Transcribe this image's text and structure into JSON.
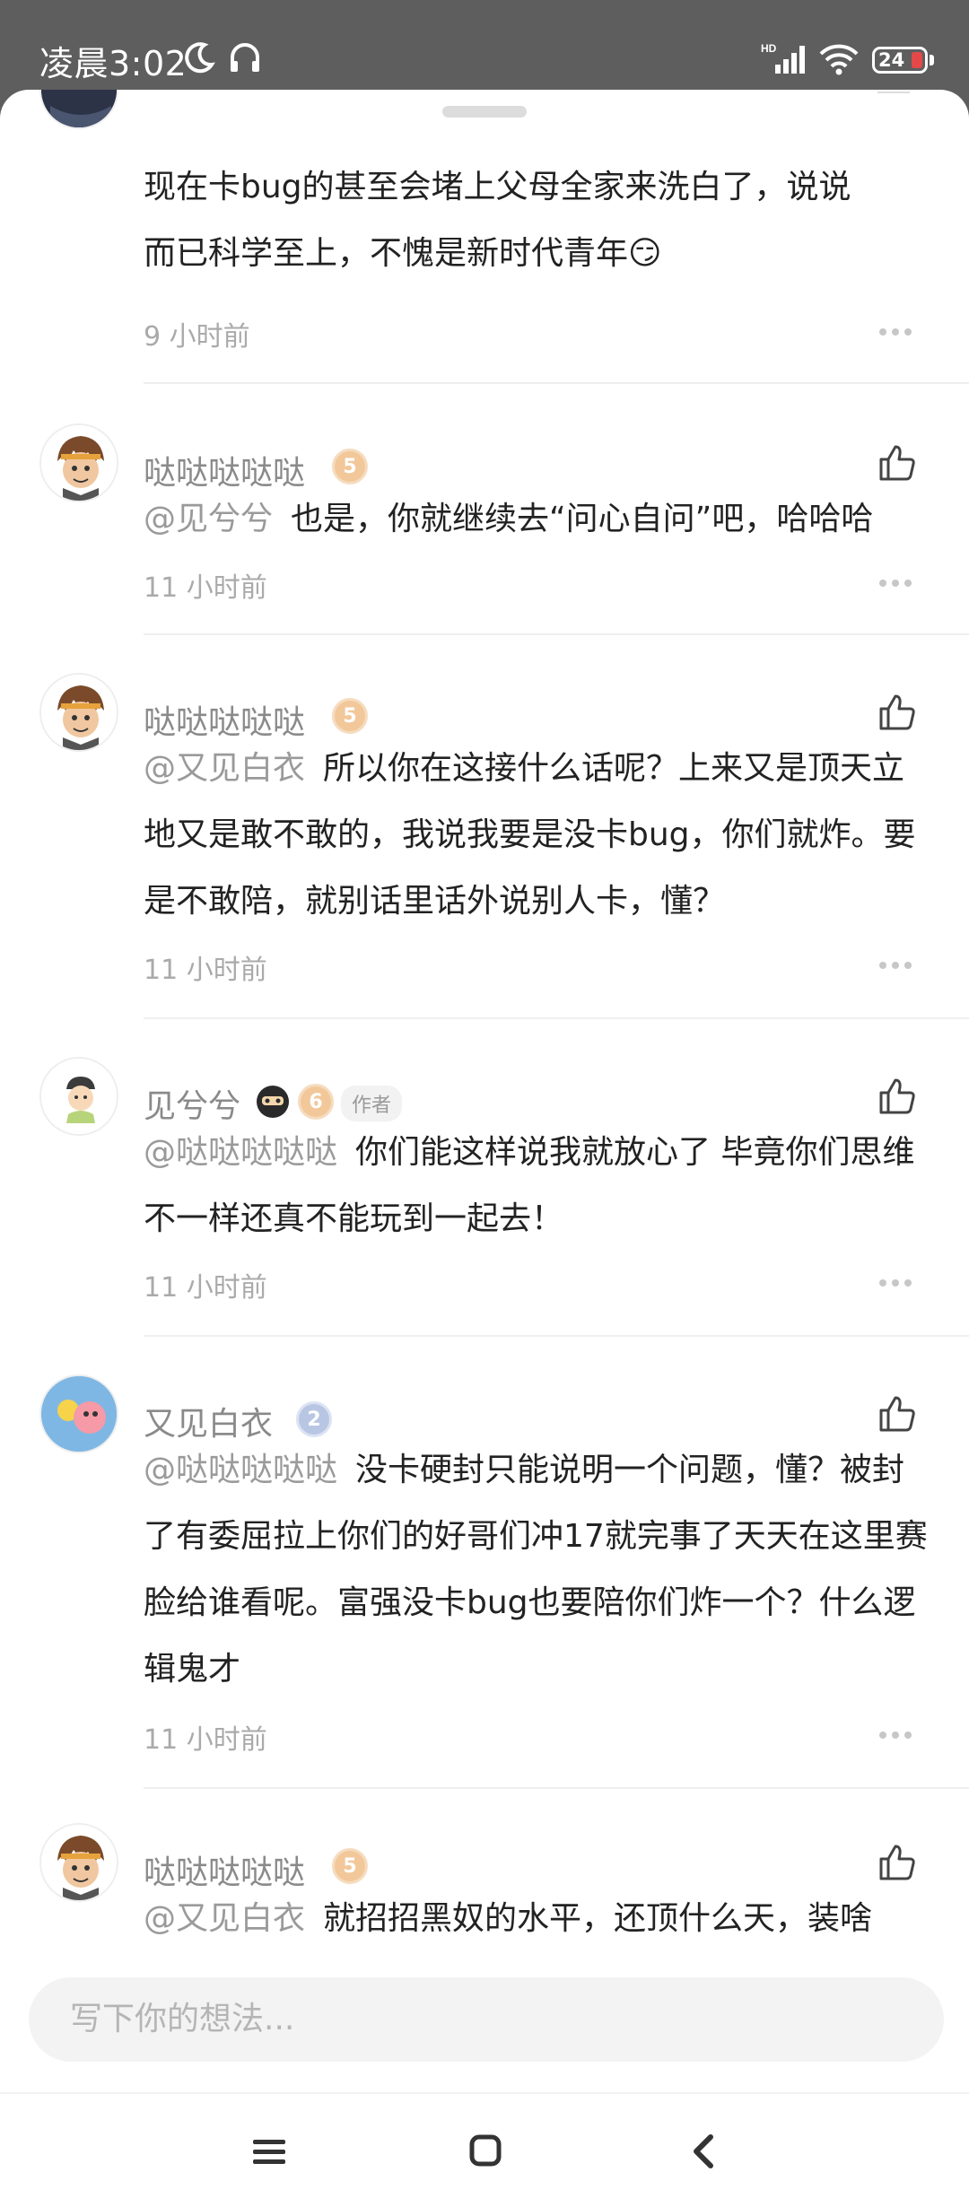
{
  "status_bar": {
    "time": "凌晨3:02",
    "battery": "24",
    "network": "HD"
  },
  "comments": [
    {
      "text_lines": [
        "现在卡bug的甚至会堵上父母全家来洗白了，说说",
        "而已科学至上，不愧是新时代青年😏"
      ],
      "time": "9 小时前"
    },
    {
      "username": "哒哒哒哒哒",
      "level": "5",
      "mention": "@见兮兮",
      "text": "也是，你就继续去“问心自问”吧，哈哈哈",
      "time": "11 小时前"
    },
    {
      "username": "哒哒哒哒哒",
      "level": "5",
      "mention": "@又见白衣",
      "text": "所以你在这接什么话呢？上来又是顶天立地又是敢不敢的，我说我要是没卡bug，你们就炸。要是不敢陪，就别话里话外说别人卡，懂？",
      "time": "11 小时前"
    },
    {
      "username": "见兮兮",
      "level": "6",
      "author_tag": "作者",
      "mention": "@哒哒哒哒哒",
      "text": "你们能这样说我就放心了 毕竟你们思维不一样还真不能玩到一起去！",
      "time": "11 小时前"
    },
    {
      "username": "又见白衣",
      "level": "2",
      "mention": "@哒哒哒哒哒",
      "text": "没卡硬封只能说明一个问题，懂？被封了有委屈拉上你们的好哥们冲17就完事了天天在这里赛脸给谁看呢。富强没卡bug也要陪你们炸一个？什么逻辑鬼才",
      "time": "11 小时前"
    },
    {
      "username": "哒哒哒哒哒",
      "level": "5",
      "mention": "@又见白衣",
      "text": "就招招黑奴的水平，还顶什么天，装啥"
    }
  ],
  "input": {
    "placeholder": "写下你的想法..."
  },
  "colors": {
    "status_bar_bg": "#5e5e5e",
    "mention": "#9a9a9a",
    "badge_gold": "#f2c89a",
    "badge_silver": "#b9c6e3"
  }
}
